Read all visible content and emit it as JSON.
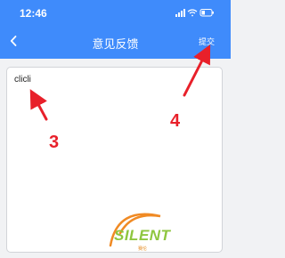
{
  "status_bar": {
    "time": "12:46",
    "icons": [
      "signal-icon",
      "wifi-icon",
      "battery-icon"
    ]
  },
  "nav": {
    "back_icon": "chevron-left-icon",
    "title": "意见反馈",
    "submit_label": "提交"
  },
  "feedback": {
    "value": "clicli"
  },
  "annotations": {
    "step_3": "3",
    "step_4": "4",
    "color": "#e8202a"
  },
  "watermark": {
    "text": "SILENT",
    "sub": "赛伦"
  },
  "colors": {
    "header": "#3f8bfb",
    "background": "#f1f2f4"
  }
}
